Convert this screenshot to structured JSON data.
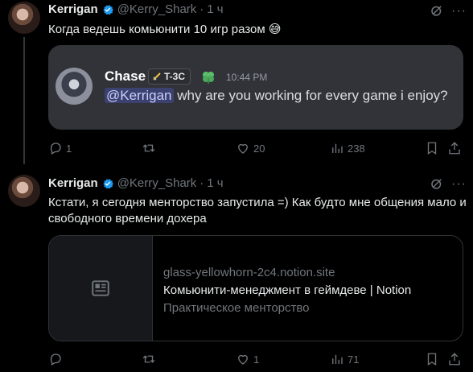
{
  "tweets": [
    {
      "author_name": "Kerrigan",
      "author_handle": "@Kerry_Shark",
      "separator": "·",
      "time": "1 ч",
      "more": "···",
      "text": "Когда ведешь комьюнити 10 игр разом 😅",
      "embed": {
        "type": "discord-screenshot",
        "username": "Chase",
        "tag": "T-3C",
        "timestamp": "10:44 PM",
        "mention": "@Kerrigan",
        "message": " why are you working for every game i enjoy?"
      },
      "stats": {
        "replies": "1",
        "retweets": "",
        "likes": "20",
        "views": "238"
      }
    },
    {
      "author_name": "Kerrigan",
      "author_handle": "@Kerry_Shark",
      "separator": "·",
      "time": "1 ч",
      "more": "···",
      "text": "Кстати, я сегодня менторство запустила =) Как будто мне общения мало и свободного времени дохера",
      "link_card": {
        "domain": "glass-yellowhorn-2c4.notion.site",
        "title": "Комьюнити-менеджмент в геймдеве | Notion",
        "description": "Практическое менторство"
      },
      "stats": {
        "replies": "",
        "retweets": "",
        "likes": "1",
        "views": "71"
      }
    }
  ],
  "colors": {
    "background": "#000000",
    "text": "#e7e9ea",
    "muted": "#71767b",
    "verified": "#1d9bf0",
    "border": "#2f3336",
    "discord_bg": "#313338",
    "mention_bg": "#3c4270"
  },
  "icons": [
    "verified-badge-icon",
    "grok-icon",
    "more-icon",
    "reply-icon",
    "retweet-icon",
    "like-icon",
    "views-icon",
    "bookmark-icon",
    "share-icon",
    "article-icon",
    "sword-icon",
    "clover-icon"
  ]
}
